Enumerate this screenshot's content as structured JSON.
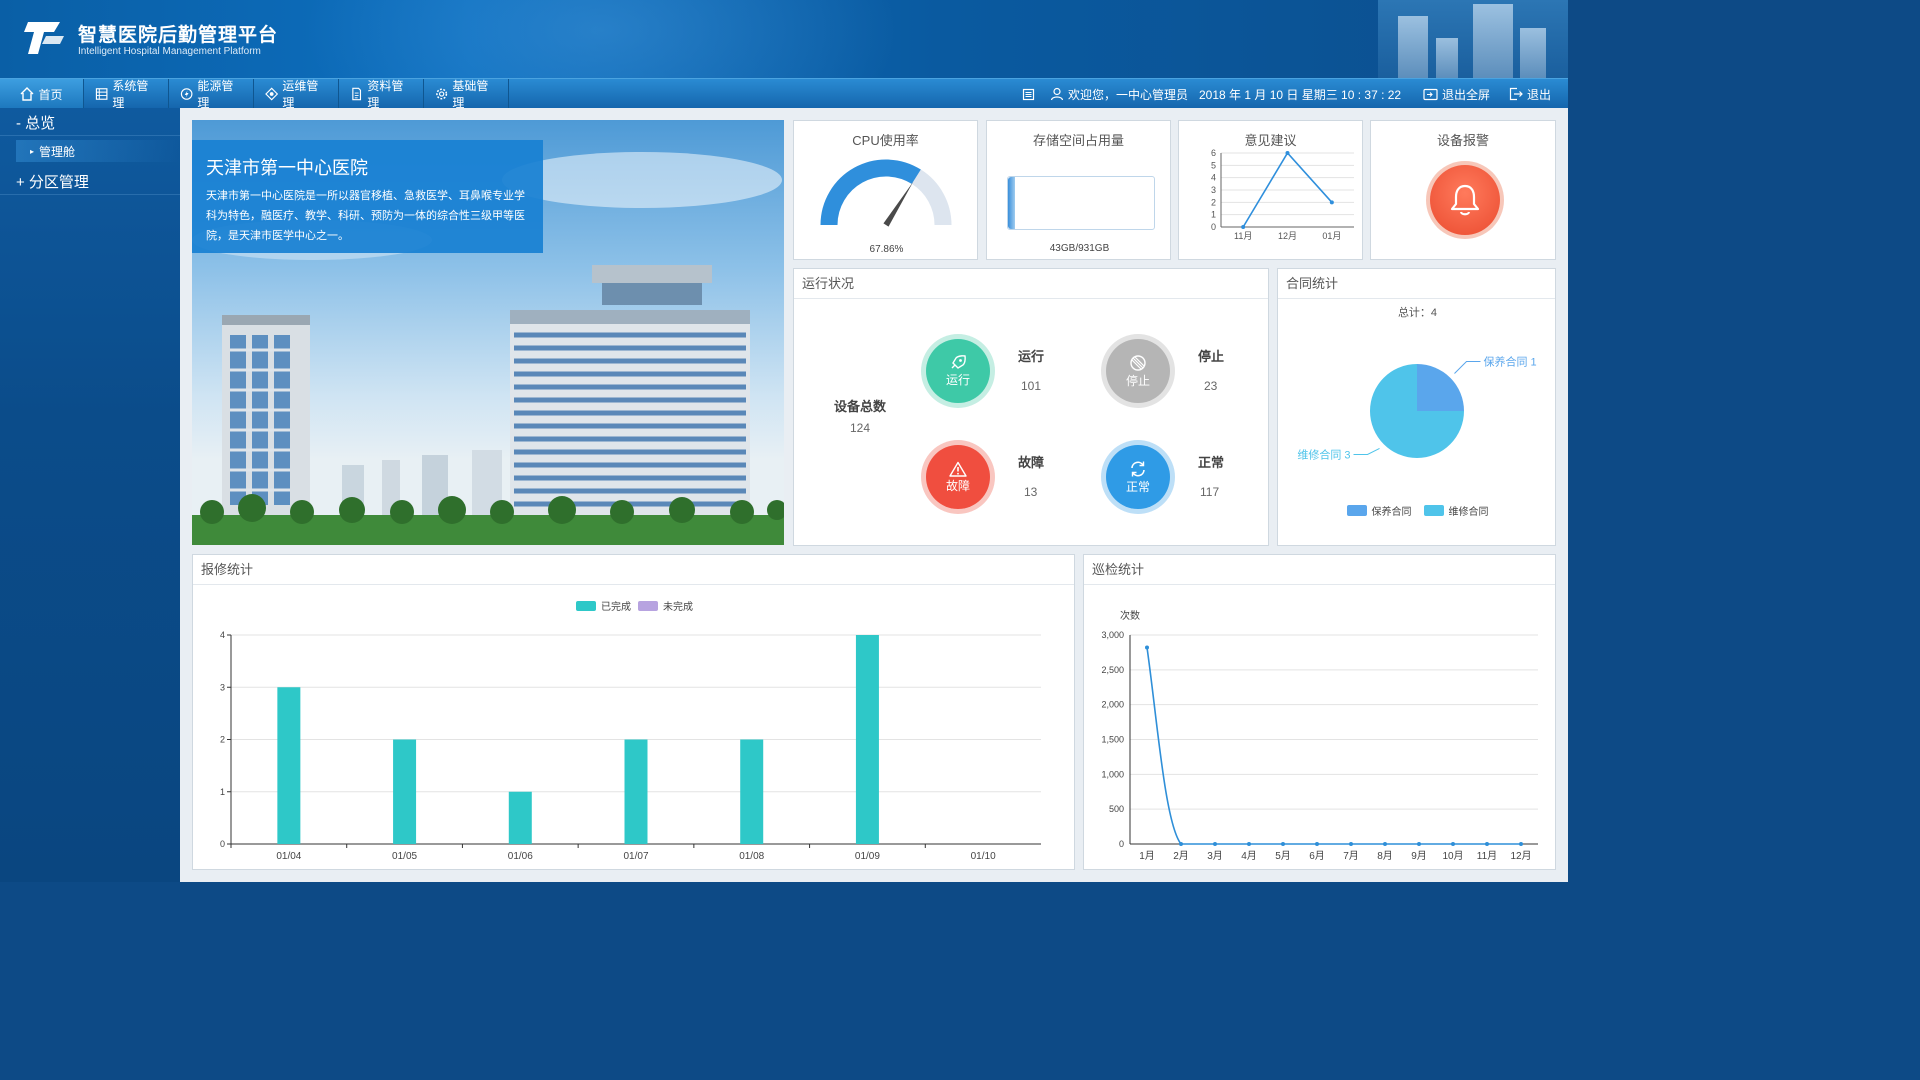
{
  "header": {
    "title_cn": "智慧医院后勤管理平台",
    "title_en": "Intelligent Hospital Management Platform"
  },
  "nav": {
    "items": [
      {
        "label": "首页",
        "icon": "home-icon"
      },
      {
        "label": "系统管理",
        "icon": "list-icon"
      },
      {
        "label": "能源管理",
        "icon": "energy-icon"
      },
      {
        "label": "运维管理",
        "icon": "maintenance-icon"
      },
      {
        "label": "资料管理",
        "icon": "document-icon"
      },
      {
        "label": "基础管理",
        "icon": "gear-icon"
      }
    ],
    "welcome": "欢迎您，一中心管理员",
    "datetime": "2018 年 1 月 10 日 星期三 10 : 37 : 22",
    "fullscreen_exit": "退出全屏",
    "logout": "退出"
  },
  "sidebar": {
    "sections": [
      {
        "label": "- 总览",
        "children": [
          "管理舱"
        ]
      },
      {
        "label": "+ 分区管理",
        "children": []
      }
    ]
  },
  "hospital": {
    "name": "天津市第一中心医院",
    "description": "天津市第一中心医院是一所以器官移植、急救医学、耳鼻喉专业学科为特色，融医疗、教学、科研、预防为一体的综合性三级甲等医院，是天津市医学中心之一。"
  },
  "cpu": {
    "title": "CPU使用率",
    "value": "67.86%",
    "fraction": 0.6786
  },
  "storage": {
    "title": "存储空间占用量",
    "value": "43GB/931GB",
    "fraction": 0.046
  },
  "feedback": {
    "title": "意见建议",
    "chart_data": {
      "type": "line",
      "x": [
        "11月",
        "12月",
        "01月"
      ],
      "values": [
        0,
        6,
        2
      ],
      "ylim": [
        0,
        6
      ],
      "yticks": [
        0,
        1,
        2,
        3,
        4,
        5,
        6
      ]
    }
  },
  "alarm": {
    "title": "设备报警",
    "icon": "bell-icon",
    "color": "#f05a3e"
  },
  "status": {
    "title": "运行状况",
    "total_label": "设备总数",
    "total_value": "124",
    "items": [
      {
        "key": "run",
        "circle_label": "运行",
        "label": "运行",
        "value": "101",
        "color": "#3ec9a7"
      },
      {
        "key": "stop",
        "circle_label": "停止",
        "label": "停止",
        "value": "23",
        "color": "#b5b5b5"
      },
      {
        "key": "fault",
        "circle_label": "故障",
        "label": "故障",
        "value": "13",
        "color": "#f04e3f"
      },
      {
        "key": "normal",
        "circle_label": "正常",
        "label": "正常",
        "value": "117",
        "color": "#2f9be6"
      }
    ]
  },
  "contracts": {
    "title": "合同统计",
    "total": "总计：4",
    "chart_data": {
      "type": "pie",
      "slices": [
        {
          "name": "保养合同",
          "value": 1,
          "label": "保养合同 1",
          "color": "#5aa6ec"
        },
        {
          "name": "维修合同",
          "value": 3,
          "label": "维修合同 3",
          "color": "#4fc4ea"
        }
      ],
      "legend": [
        "保养合同",
        "维修合同"
      ]
    }
  },
  "repairs": {
    "title": "报修统计",
    "chart_data": {
      "type": "bar",
      "categories": [
        "01/04",
        "01/05",
        "01/06",
        "01/07",
        "01/08",
        "01/09",
        "01/10"
      ],
      "series": [
        {
          "name": "已完成",
          "values": [
            3,
            2,
            1,
            2,
            2,
            4,
            0
          ],
          "color": "#2ec8c8"
        },
        {
          "name": "未完成",
          "values": [
            0,
            0,
            0,
            0,
            0,
            0,
            0
          ],
          "color": "#b7a3e0"
        }
      ],
      "ylim": [
        0,
        4
      ],
      "yticks": [
        0,
        1,
        2,
        3,
        4
      ]
    }
  },
  "inspections": {
    "title": "巡检统计",
    "chart_data": {
      "type": "line",
      "ylabel": "次数",
      "x": [
        "1月",
        "2月",
        "3月",
        "4月",
        "5月",
        "6月",
        "7月",
        "8月",
        "9月",
        "10月",
        "11月",
        "12月"
      ],
      "values": [
        2820,
        0,
        0,
        0,
        0,
        0,
        0,
        0,
        0,
        0,
        0,
        0
      ],
      "ylim": [
        0,
        3000
      ],
      "yticks": [
        0,
        500,
        1000,
        1500,
        2000,
        2500,
        3000
      ],
      "ytick_labels": [
        "0",
        "500",
        "1,000",
        "1,500",
        "2,000",
        "2,500",
        "3,000"
      ],
      "color": "#2f8fd8"
    }
  }
}
